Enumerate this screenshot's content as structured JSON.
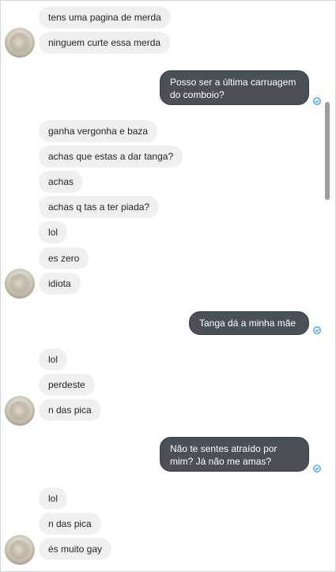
{
  "messages": [
    {
      "from": "them",
      "text": "tens uma pagina de merda"
    },
    {
      "from": "them",
      "text": "ninguem curte essa merda"
    },
    {
      "from": "me",
      "text": "Posso ser a última carruagem do comboio?"
    },
    {
      "from": "them",
      "text": "ganha vergonha e baza"
    },
    {
      "from": "them",
      "text": "achas que estas a dar tanga?"
    },
    {
      "from": "them",
      "text": "achas"
    },
    {
      "from": "them",
      "text": "achas q tas a ter piada?"
    },
    {
      "from": "them",
      "text": "lol"
    },
    {
      "from": "them",
      "text": "es zero"
    },
    {
      "from": "them",
      "text": "idiota"
    },
    {
      "from": "me",
      "text": "Tanga dá a minha mãe"
    },
    {
      "from": "them",
      "text": "lol"
    },
    {
      "from": "them",
      "text": "perdeste"
    },
    {
      "from": "them",
      "text": "n das pica"
    },
    {
      "from": "me",
      "text": "Não te sentes atraído por mim? Já não me amas?"
    },
    {
      "from": "them",
      "text": "lol"
    },
    {
      "from": "them",
      "text": "n das pica"
    },
    {
      "from": "them",
      "text": "és muito gay"
    }
  ],
  "colors": {
    "incoming_bubble": "#f1f0f0",
    "outgoing_bubble": "#4b4f56",
    "seen_icon": "#0084ff"
  },
  "icons": {
    "seen": "check-circle-icon",
    "scrollbar": "scrollbar-thumb"
  }
}
